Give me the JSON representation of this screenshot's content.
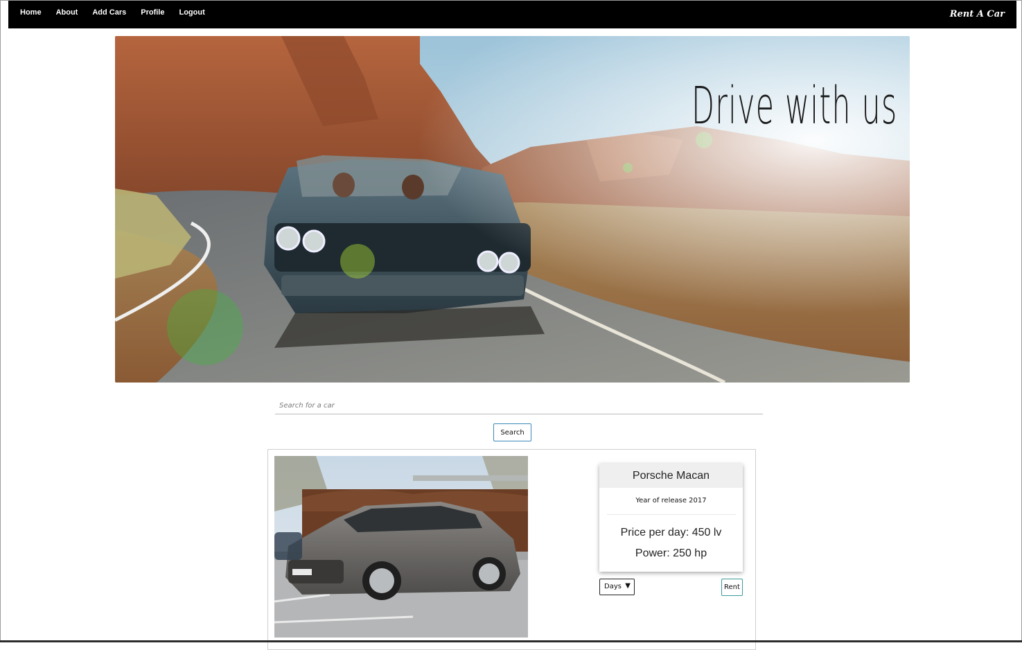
{
  "nav": {
    "links": [
      "Home",
      "About",
      "Add Cars",
      "Profile",
      "Logout"
    ],
    "brand": "Rent A Car"
  },
  "hero": {
    "title": "Drive with us",
    "image": "convertible-car-desert-road-photo"
  },
  "search": {
    "placeholder": "Search for a car",
    "button": "Search"
  },
  "car": {
    "name": "Porsche Macan",
    "year": "Year of release 2017",
    "price": "Price per day: 450 lv",
    "power": "Power: 250 hp",
    "image": "grey-porsche-macan-photo",
    "days_label": "Days",
    "days_arrow": "▼",
    "rent_button": "Rent"
  },
  "colors": {
    "navbar": "#000000",
    "button_border": "#3a89b8"
  }
}
